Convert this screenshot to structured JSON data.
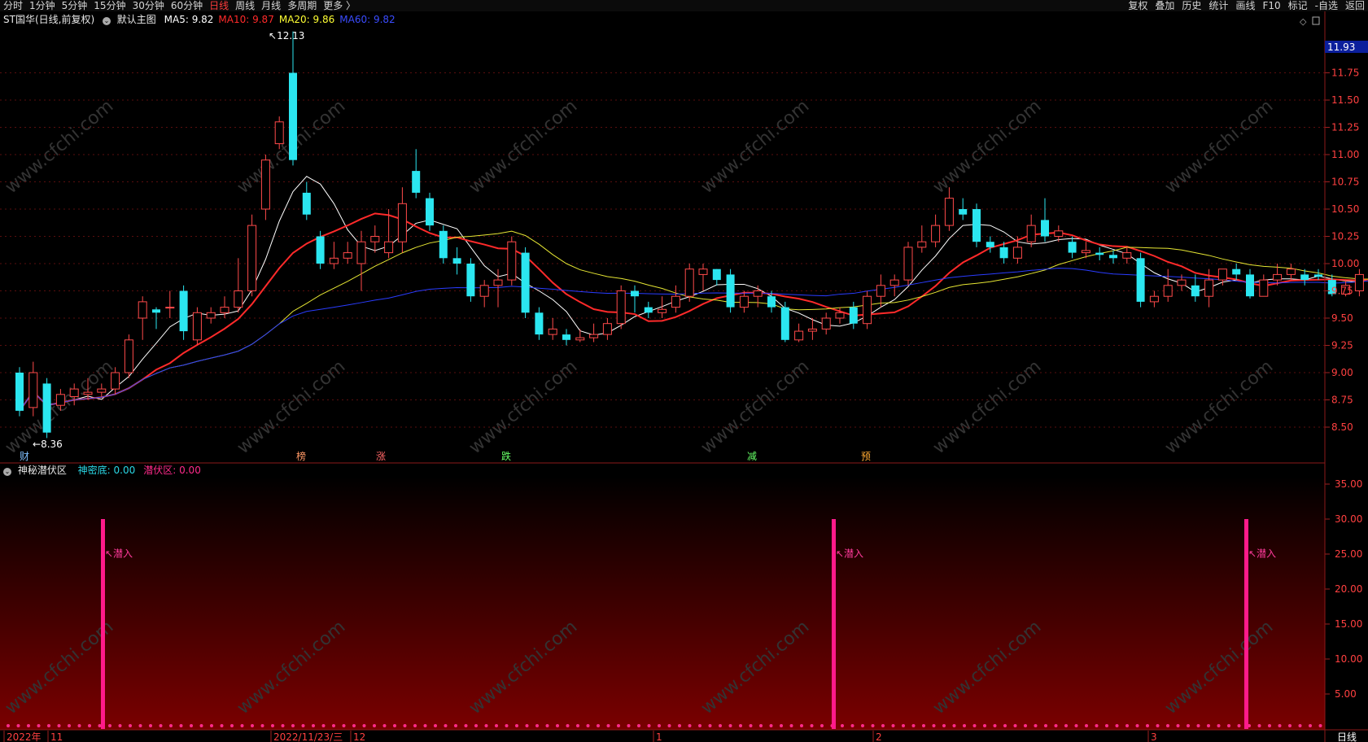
{
  "toolbar": {
    "left_items": [
      "分时",
      "1分钟",
      "5分钟",
      "15分钟",
      "30分钟",
      "60分钟",
      "日线",
      "周线",
      "月线",
      "多周期",
      "更多 〉"
    ],
    "active": "日线",
    "right_items": [
      "复权",
      "叠加",
      "历史",
      "统计",
      "画线",
      "F10",
      "标记",
      "-自选",
      "返回"
    ]
  },
  "main_panel": {
    "stock_name": "ST国华",
    "mode": "(日线,前复权)",
    "chart_name": "默认主图",
    "ma": [
      {
        "label": "MA5: 9.82",
        "color": "#ffffff"
      },
      {
        "label": "MA10: 9.87",
        "color": "#ff2a2a"
      },
      {
        "label": "MA20: 9.86",
        "color": "#ffff33"
      },
      {
        "label": "MA60: 9.82",
        "color": "#3a4cff"
      }
    ],
    "current_price": "11.93",
    "high_label": "12.13",
    "low_label": "8.36",
    "price_ticks": [
      "11.75",
      "11.50",
      "11.25",
      "11.00",
      "10.75",
      "10.50",
      "10.25",
      "10.00",
      "9.75",
      "9.50",
      "9.25",
      "9.00",
      "8.75",
      "8.50"
    ],
    "signals": [
      {
        "text": "财",
        "color": "#7fbfff"
      },
      {
        "text": "榜",
        "color": "#ff9966"
      },
      {
        "text": "涨",
        "color": "#ff6666"
      },
      {
        "text": "跌",
        "color": "#66ff66"
      },
      {
        "text": "减",
        "color": "#66ff66"
      },
      {
        "text": "预",
        "color": "#ffaa33"
      }
    ]
  },
  "sub_panel": {
    "indicator_name": "神秘潜伏区",
    "values": [
      {
        "label": "神密底: 0.00",
        "color": "#2ad7e6"
      },
      {
        "label": "潜伏区: 0.00",
        "color": "#ff2a8a"
      }
    ],
    "ticks": [
      "35.00",
      "30.00",
      "25.00",
      "20.00",
      "15.00",
      "10.00",
      "5.00"
    ],
    "marker_label": "潜入"
  },
  "date_axis": {
    "labels": [
      "2022年",
      "11",
      "2022/11/23/三",
      "12",
      "1",
      "2",
      "3"
    ],
    "period": "日线"
  },
  "watermark": "www.cfchi.com",
  "icons": [
    "chevron-circle-icon",
    "diamond-icon",
    "panel-toggle-icon"
  ]
}
